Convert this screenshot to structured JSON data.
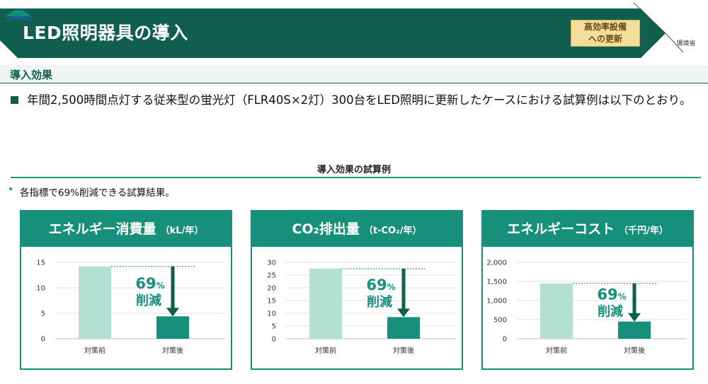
{
  "header": {
    "title": "LED照明器具の導入",
    "badge_line1": "高効率設備",
    "badge_line2": "への更新",
    "logo_text": "環境省",
    "colors": {
      "primary": "#0f5e4e",
      "accent": "#17907b",
      "light_bar": "#b2e0d3",
      "badge_bg": "#f3df9a"
    }
  },
  "section": {
    "title": "導入効果"
  },
  "main_text": "年間2,500時間点灯する従来型の蛍光灯（FLR40S×2灯）300台をLED照明に更新したケースにおける試算例は以下のとおり。",
  "subsection": {
    "title": "導入効果の試算例"
  },
  "note": "各指標で69%削減できる試算結果。",
  "chart_data": [
    {
      "type": "bar",
      "title": "エネルギー消費量",
      "unit": "（kL/年）",
      "categories": [
        "対策前",
        "対策後"
      ],
      "values": [
        14.2,
        4.4
      ],
      "ylim": [
        0,
        15
      ],
      "ticks": [
        0,
        5,
        10,
        15
      ],
      "tick_labels": [
        "0",
        "5",
        "10",
        "15"
      ],
      "reduction_num": "69",
      "reduction_pct": "%",
      "reduction_word": "削減"
    },
    {
      "type": "bar",
      "title": "CO₂排出量",
      "unit": "（t-CO₂/年）",
      "categories": [
        "対策前",
        "対策後"
      ],
      "values": [
        27.5,
        8.5
      ],
      "ylim": [
        0,
        30
      ],
      "ticks": [
        0,
        5,
        10,
        15,
        20,
        25,
        30
      ],
      "tick_labels": [
        "0",
        "5",
        "10",
        "15",
        "20",
        "25",
        "30"
      ],
      "reduction_num": "69",
      "reduction_pct": "%",
      "reduction_word": "削減"
    },
    {
      "type": "bar",
      "title": "エネルギーコスト",
      "unit": "（千円/年）",
      "categories": [
        "対策前",
        "対策後"
      ],
      "values": [
        1450,
        450
      ],
      "ylim": [
        0,
        2000
      ],
      "ticks": [
        0,
        500,
        1000,
        1500,
        2000
      ],
      "tick_labels": [
        "0",
        "500",
        "1,000",
        "1,500",
        "2,000"
      ],
      "reduction_num": "69",
      "reduction_pct": "%",
      "reduction_word": "削減"
    }
  ]
}
